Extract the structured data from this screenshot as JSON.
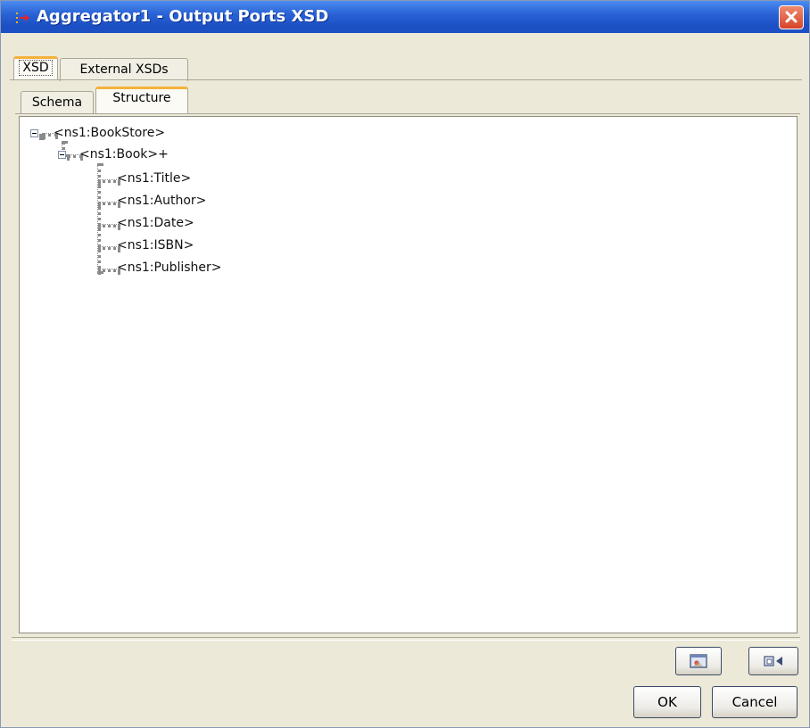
{
  "window": {
    "title": "Aggregator1 - Output Ports XSD",
    "close_icon": "close-icon"
  },
  "outer_tabs": [
    {
      "label": "XSD",
      "active": true
    },
    {
      "label": "External XSDs",
      "active": false
    }
  ],
  "inner_tabs": [
    {
      "label": "Schema",
      "active": false
    },
    {
      "label": "Structure",
      "active": true
    }
  ],
  "tree": {
    "root": {
      "label": "<ns1:BookStore>",
      "expanded": true
    },
    "book": {
      "label": "<ns1:Book>+",
      "expanded": true
    },
    "children": [
      {
        "label": "<ns1:Title>"
      },
      {
        "label": "<ns1:Author>"
      },
      {
        "label": "<ns1:Date>"
      },
      {
        "label": "<ns1:ISBN>"
      },
      {
        "label": "<ns1:Publisher>"
      }
    ]
  },
  "toolbar_icons": [
    "image-view-icon",
    "export-icon"
  ],
  "buttons": {
    "ok": "OK",
    "cancel": "Cancel"
  },
  "colors": {
    "titlebar": "#2a63d6",
    "dialog_bg": "#ece9d8",
    "active_tab_accent": "#f4b23c",
    "close_button": "#d7452a"
  }
}
